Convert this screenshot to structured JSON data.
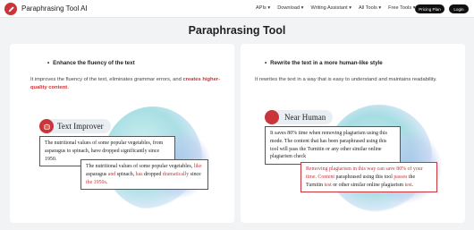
{
  "nav": {
    "brand": "Paraphrasing Tool AI",
    "logo_icon": "pen-icon",
    "menu": [
      "APIs ▾",
      "Download ▾",
      "Writing Assistant ▾",
      "All Tools ▾",
      "Free Tools ▾"
    ],
    "pricing": "Pricing Plan",
    "login": "Login"
  },
  "page": {
    "title": "Paraphrasing Tool"
  },
  "left_card": {
    "heading": "Enhance the fluency of the text",
    "desc_a": "It improves the fluency of the text, eliminates grammar errors, and ",
    "desc_b": "creates higher-quality content",
    "desc_c": ".",
    "pill": "Text Improver",
    "before_text": "The nutritional values of some popular vegetables, from asparagus to spinach, have dropped significantly since 1950.",
    "after_parts": [
      "The nutritional values of some popular vegetables, ",
      "like",
      " asparagus ",
      "and",
      " spinach, ",
      "has",
      " dropped ",
      "dramatically",
      " since ",
      "the 1950s",
      "."
    ]
  },
  "right_card": {
    "heading": "Rewrite the text in a more human-like style",
    "desc": "It rewrites the text in a way that is easy to understand and maintains readability.",
    "pill": "Near Human",
    "before_text": "It saves 80% time when removing plagiarism using this mode. The content that has been paraphrased using this tool will pass the Turnitin or any other similar online plagiarism check",
    "after_parts": [
      "Removing plagiarism in this way can save 80% of your time. Content",
      " paraphrased using this tool ",
      "passes",
      " the Turnitin ",
      "test",
      " or other similar online plagiarism ",
      "test",
      "."
    ]
  },
  "colors": {
    "accent": "#c9353a",
    "background": "#f2f3f5"
  }
}
